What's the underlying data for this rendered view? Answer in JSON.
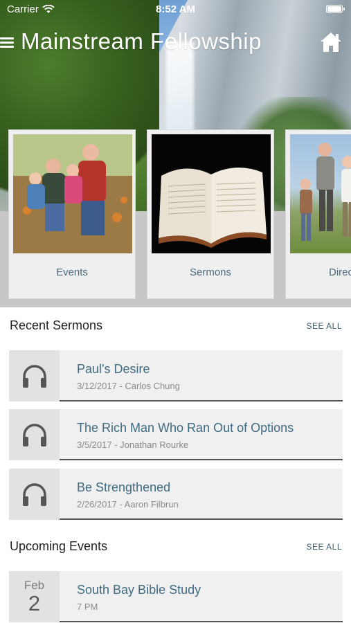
{
  "status_bar": {
    "carrier": "Carrier",
    "time": "8:52 AM"
  },
  "nav": {
    "title": "Mainstream Fellowship",
    "menu_icon": "hamburger-menu-icon",
    "home_icon": "home-icon"
  },
  "cards": [
    {
      "label": "Events",
      "image": "family-photo"
    },
    {
      "label": "Sermons",
      "image": "open-bible-photo"
    },
    {
      "label": "Direc",
      "image": "family-walking-photo"
    }
  ],
  "recent_sermons": {
    "heading": "Recent Sermons",
    "see_all": "SEE ALL",
    "items": [
      {
        "title": "Paul's Desire",
        "meta": "3/12/2017 - Carlos Chung",
        "icon": "headphones-icon"
      },
      {
        "title": "The Rich Man Who Ran Out of Options",
        "meta": "3/5/2017 - Jonathan Rourke",
        "icon": "headphones-icon"
      },
      {
        "title": "Be Strengthened",
        "meta": "2/26/2017 - Aaron Filbrun",
        "icon": "headphones-icon"
      }
    ]
  },
  "upcoming_events": {
    "heading": "Upcoming Events",
    "see_all": "SEE ALL",
    "items": [
      {
        "month": "Feb",
        "day": "2",
        "title": "South Bay Bible Study",
        "meta": "7 PM"
      }
    ]
  },
  "colors": {
    "accent_text": "#3f6a80",
    "card_label": "#4a6b7d",
    "row_bg": "#f0f0f0",
    "icon_box_bg": "#e2e2e2"
  }
}
